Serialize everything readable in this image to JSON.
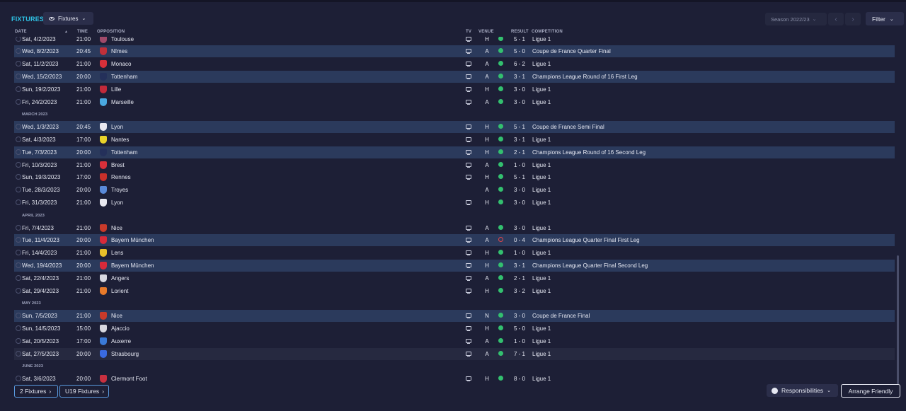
{
  "header": {
    "title": "FIXTURES",
    "view_label": "Fixtures",
    "season_label": "Season 2022/23",
    "filter_label": "Filter"
  },
  "columns": {
    "date": "DATE",
    "time": "TIME",
    "opposition": "OPPOSITION",
    "tv": "TV",
    "venue": "VENUE",
    "result": "RESULT",
    "competition": "COMPETITION"
  },
  "rows": [
    {
      "kind": "match",
      "date": "Sat, 4/2/2023",
      "time": "21:00",
      "opp": "Toulouse",
      "crest": "#a04a6a",
      "tv": true,
      "venue": "H",
      "outcome": "win",
      "score": "5 - 1",
      "comp": "Ligue 1",
      "style": "plain"
    },
    {
      "kind": "match",
      "date": "Wed, 8/2/2023",
      "time": "20:45",
      "opp": "Nîmes",
      "crest": "#c0303a",
      "tv": true,
      "venue": "A",
      "outcome": "win",
      "score": "5 - 0",
      "comp": "Coupe de France Quarter Final",
      "style": "hl"
    },
    {
      "kind": "match",
      "date": "Sat, 11/2/2023",
      "time": "21:00",
      "opp": "Monaco",
      "crest": "#d8303a",
      "tv": true,
      "venue": "A",
      "outcome": "win",
      "score": "6 - 2",
      "comp": "Ligue 1",
      "style": "plain"
    },
    {
      "kind": "match",
      "date": "Wed, 15/2/2023",
      "time": "20:00",
      "opp": "Tottenham",
      "crest": "#24305a",
      "tv": true,
      "venue": "A",
      "outcome": "win",
      "score": "3 - 1",
      "comp": "Champions League Round of 16 First Leg",
      "style": "hl"
    },
    {
      "kind": "match",
      "date": "Sun, 19/2/2023",
      "time": "21:00",
      "opp": "Lille",
      "crest": "#c22a3a",
      "tv": true,
      "venue": "H",
      "outcome": "win",
      "score": "3 - 0",
      "comp": "Ligue 1",
      "style": "plain"
    },
    {
      "kind": "match",
      "date": "Fri, 24/2/2023",
      "time": "21:00",
      "opp": "Marseille",
      "crest": "#4aa8e0",
      "tv": true,
      "venue": "A",
      "outcome": "win",
      "score": "3 - 0",
      "comp": "Ligue 1",
      "style": "plain"
    },
    {
      "kind": "month",
      "label": "MARCH 2023"
    },
    {
      "kind": "match",
      "date": "Wed, 1/3/2023",
      "time": "20:45",
      "opp": "Lyon",
      "crest": "#e8e8f0",
      "tv": true,
      "venue": "H",
      "outcome": "win",
      "score": "5 - 1",
      "comp": "Coupe de France Semi Final",
      "style": "hl"
    },
    {
      "kind": "match",
      "date": "Sat, 4/3/2023",
      "time": "17:00",
      "opp": "Nantes",
      "crest": "#e8d22a",
      "tv": true,
      "venue": "H",
      "outcome": "win",
      "score": "3 - 1",
      "comp": "Ligue 1",
      "style": "plain"
    },
    {
      "kind": "match",
      "date": "Tue, 7/3/2023",
      "time": "20:00",
      "opp": "Tottenham",
      "crest": "#24305a",
      "tv": true,
      "venue": "H",
      "outcome": "win",
      "score": "2 - 1",
      "comp": "Champions League Round of 16 Second Leg",
      "style": "hl"
    },
    {
      "kind": "match",
      "date": "Fri, 10/3/2023",
      "time": "21:00",
      "opp": "Brest",
      "crest": "#d8303a",
      "tv": true,
      "venue": "A",
      "outcome": "win",
      "score": "1 - 0",
      "comp": "Ligue 1",
      "style": "plain"
    },
    {
      "kind": "match",
      "date": "Sun, 19/3/2023",
      "time": "17:00",
      "opp": "Rennes",
      "crest": "#c8302a",
      "tv": true,
      "venue": "H",
      "outcome": "win",
      "score": "5 - 1",
      "comp": "Ligue 1",
      "style": "plain"
    },
    {
      "kind": "match",
      "date": "Tue, 28/3/2023",
      "time": "20:00",
      "opp": "Troyes",
      "crest": "#5a8ad8",
      "tv": false,
      "venue": "A",
      "outcome": "win",
      "score": "3 - 0",
      "comp": "Ligue 1",
      "style": "plain"
    },
    {
      "kind": "match",
      "date": "Fri, 31/3/2023",
      "time": "21:00",
      "opp": "Lyon",
      "crest": "#e8e8f0",
      "tv": true,
      "venue": "H",
      "outcome": "win",
      "score": "3 - 0",
      "comp": "Ligue 1",
      "style": "plain"
    },
    {
      "kind": "month",
      "label": "APRIL 2023"
    },
    {
      "kind": "match",
      "date": "Fri, 7/4/2023",
      "time": "21:00",
      "opp": "Nice",
      "crest": "#c83a2a",
      "tv": true,
      "venue": "A",
      "outcome": "win",
      "score": "3 - 0",
      "comp": "Ligue 1",
      "style": "plain"
    },
    {
      "kind": "match",
      "date": "Tue, 11/4/2023",
      "time": "20:00",
      "opp": "Bayern München",
      "crest": "#d82a3a",
      "tv": true,
      "venue": "A",
      "outcome": "loss",
      "score": "0 - 4",
      "comp": "Champions League Quarter Final First Leg",
      "style": "hl"
    },
    {
      "kind": "match",
      "date": "Fri, 14/4/2023",
      "time": "21:00",
      "opp": "Lens",
      "crest": "#e8c02a",
      "tv": true,
      "venue": "H",
      "outcome": "win",
      "score": "1 - 0",
      "comp": "Ligue 1",
      "style": "plain"
    },
    {
      "kind": "match",
      "date": "Wed, 19/4/2023",
      "time": "20:00",
      "opp": "Bayern München",
      "crest": "#d82a3a",
      "tv": true,
      "venue": "H",
      "outcome": "win",
      "score": "3 - 1",
      "comp": "Champions League Quarter Final Second Leg",
      "style": "hl"
    },
    {
      "kind": "match",
      "date": "Sat, 22/4/2023",
      "time": "21:00",
      "opp": "Angers",
      "crest": "#d8d8e0",
      "tv": true,
      "venue": "A",
      "outcome": "win",
      "score": "2 - 1",
      "comp": "Ligue 1",
      "style": "plain"
    },
    {
      "kind": "match",
      "date": "Sat, 29/4/2023",
      "time": "21:00",
      "opp": "Lorient",
      "crest": "#e87a2a",
      "tv": true,
      "venue": "H",
      "outcome": "win",
      "score": "3 - 2",
      "comp": "Ligue 1",
      "style": "plain"
    },
    {
      "kind": "month",
      "label": "MAY 2023"
    },
    {
      "kind": "match",
      "date": "Sun, 7/5/2023",
      "time": "21:00",
      "opp": "Nice",
      "crest": "#c83a2a",
      "tv": true,
      "venue": "N",
      "outcome": "win",
      "score": "3 - 0",
      "comp": "Coupe de France Final",
      "style": "hl"
    },
    {
      "kind": "match",
      "date": "Sun, 14/5/2023",
      "time": "15:00",
      "opp": "Ajaccio",
      "crest": "#d8d8e0",
      "tv": true,
      "venue": "H",
      "outcome": "win",
      "score": "5 - 0",
      "comp": "Ligue 1",
      "style": "plain"
    },
    {
      "kind": "match",
      "date": "Sat, 20/5/2023",
      "time": "17:00",
      "opp": "Auxerre",
      "crest": "#3a7ad8",
      "tv": true,
      "venue": "A",
      "outcome": "win",
      "score": "1 - 0",
      "comp": "Ligue 1",
      "style": "plain"
    },
    {
      "kind": "match",
      "date": "Sat, 27/5/2023",
      "time": "20:00",
      "opp": "Strasbourg",
      "crest": "#3a6ae0",
      "tv": true,
      "venue": "A",
      "outcome": "win",
      "score": "7 - 1",
      "comp": "Ligue 1",
      "style": "alt"
    },
    {
      "kind": "month",
      "label": "JUNE 2023"
    },
    {
      "kind": "match",
      "date": "Sat, 3/6/2023",
      "time": "20:00",
      "opp": "Clermont Foot",
      "crest": "#c83040",
      "tv": true,
      "venue": "H",
      "outcome": "win",
      "score": "8 - 0",
      "comp": "Ligue 1",
      "style": "plain"
    }
  ],
  "footer": {
    "fixtures_2": "2 Fixtures",
    "fixtures_u19": "U19 Fixtures",
    "responsibilities": "Responsibilities",
    "arrange_friendly": "Arrange Friendly"
  }
}
